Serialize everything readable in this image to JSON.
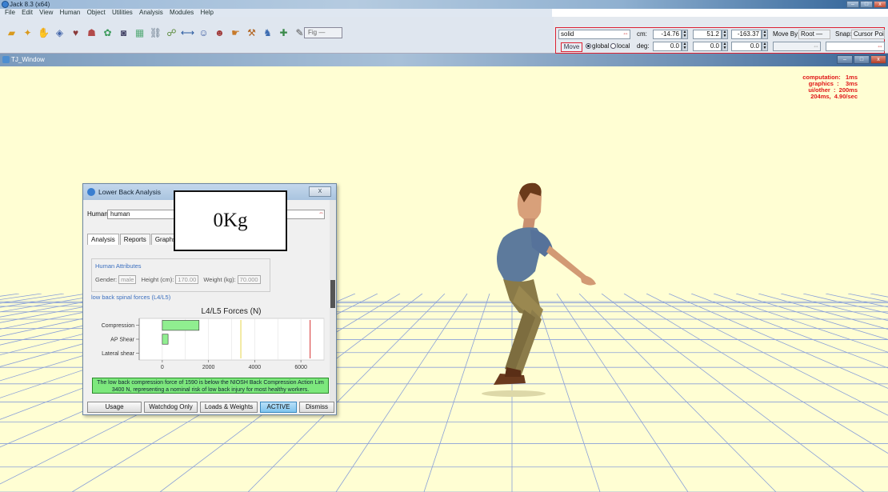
{
  "app": {
    "title": "Jack 8.3 (x64)",
    "menu": [
      "File",
      "Edit",
      "View",
      "Human",
      "Object",
      "Utilities",
      "Analysis",
      "Modules",
      "Help"
    ],
    "fig_label": "Fig"
  },
  "toolbar_icons": [
    "open-folder-icon",
    "sparkle-icon",
    "hand-icon",
    "figure-icon",
    "torso-icon",
    "body-icon",
    "color-wheel-icon",
    "camera-icon",
    "hierarchy-icon",
    "lock-icon",
    "constraint-icon",
    "ruler-icon",
    "human-add-icon",
    "human-delete-icon",
    "grasp-icon",
    "lift-icon",
    "walk-icon",
    "posture-icon",
    "brush-icon"
  ],
  "controls": {
    "shape_value": "solid",
    "cm_label": "cm:",
    "deg_label": "deg:",
    "cm_values": [
      "-14.76",
      "51.2",
      "-163.37"
    ],
    "deg_values": [
      "0.0",
      "0.0",
      "0.0"
    ],
    "move_label": "Move",
    "global_label": "global",
    "local_label": "local",
    "move_by_label": "Move By:",
    "move_by_value": "Root",
    "snap_label": "Snap:",
    "snap_value": "Cursor Point"
  },
  "viewport": {
    "title": "TJ_Window",
    "stats": "computation:   1ms\ngraphics  :    3ms\nui/other  :  200ms\n204ms,  4.90/sec"
  },
  "dialog": {
    "title": "Lower Back Analysis",
    "close_label": "X",
    "human_label": "Human",
    "human_value": "human",
    "tabs": [
      "Analysis",
      "Reports",
      "Graphs"
    ],
    "attrs_heading": "Human Attributes",
    "gender_label": "Gender:",
    "gender_value": "male",
    "height_label": "Height (cm):",
    "height_value": "170.00",
    "weight_label": "Weight (kg):",
    "weight_value": "70.000",
    "spinal_label": "low back spinal forces (L4/L5)",
    "message_line1": "The low back compression force of 1590 is below the NIOSH Back Compression Action Lim",
    "message_line2": "3400 N, representing a nominal risk of low back injury for most healthy workers.",
    "buttons": [
      "Usage",
      "Watchdog Only",
      "Loads & Weights",
      "ACTIVE",
      "Dismiss"
    ]
  },
  "overlay_text": "0Kg",
  "colors": {
    "viewport_bg": "#fffed3",
    "grid": "#8aa0d8",
    "bar": "#90ee90",
    "action_limit": "#e8d44a",
    "max_limit": "#d43030",
    "message_bg": "#7de87d"
  },
  "chart_data": {
    "type": "bar",
    "orientation": "horizontal",
    "title": "L4/L5 Forces (N)",
    "categories": [
      "Compression",
      "AP Shear",
      "Lateral shear"
    ],
    "values": [
      1590,
      250,
      0
    ],
    "xlim": [
      -1000,
      7000
    ],
    "xticks": [
      0,
      2000,
      4000,
      6000
    ],
    "reference_lines": [
      {
        "value": 3400,
        "color": "#e8d44a"
      },
      {
        "value": 6400,
        "color": "#d43030"
      }
    ],
    "grid": true
  }
}
